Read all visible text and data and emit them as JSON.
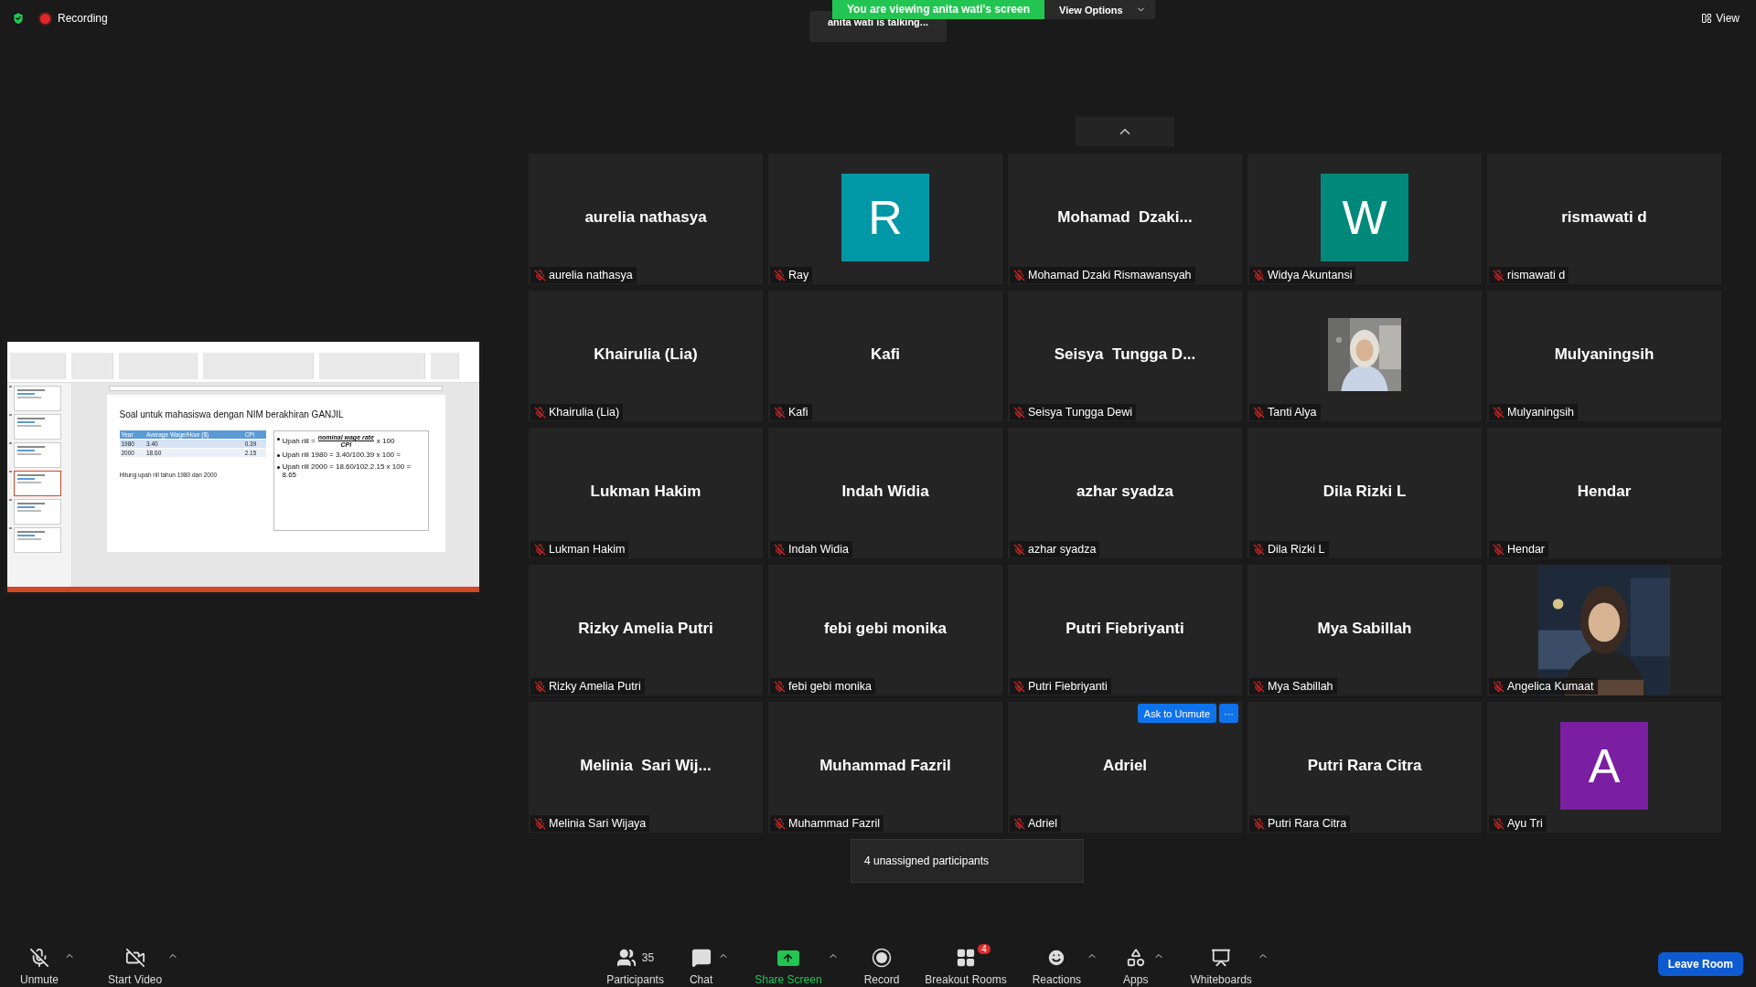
{
  "top_bar": {
    "recording_label": "Recording",
    "banner": "You are viewing anita wati's screen",
    "view_options": "View Options",
    "talking": "anita wati is talking...",
    "view": "View"
  },
  "shared_screen": {
    "slides": [
      {
        "selected": false
      },
      {
        "selected": false
      },
      {
        "selected": false
      },
      {
        "selected": true
      },
      {
        "selected": false
      },
      {
        "selected": false
      }
    ],
    "slide": {
      "title": "Soal untuk mahasiswa dengan NIM berakhiran GANJIL",
      "table": {
        "columns": [
          "Year",
          "Average Wage/Hour ($)",
          "CPI"
        ],
        "rows": [
          [
            "1980",
            "3.40",
            "0.39"
          ],
          [
            "2000",
            "18.60",
            "2.15"
          ]
        ]
      },
      "note": "Hitung upah riil tahun 1980 dan 2000",
      "bullets": [
        {
          "kind": "fraction",
          "before": "Upah riil =",
          "numerator": "nominal wage rate",
          "denominator": "CPI",
          "after": "x 100"
        },
        {
          "kind": "text",
          "text": "Upah riil 1980 = 3.40/100.39 x 100 ="
        },
        {
          "kind": "text",
          "text": "Upah riil 2000 = 18.60/102.2.15 x 100 = 8.65"
        }
      ]
    }
  },
  "tiles": [
    {
      "kind": "name",
      "display": "aurelia nathasya",
      "name": "aurelia nathasya",
      "muted": true
    },
    {
      "kind": "avatar",
      "letter": "R",
      "color": "#0097a7",
      "name": "Ray",
      "muted": true
    },
    {
      "kind": "name",
      "display": "Mohamad  Dzaki...",
      "name": "Mohamad Dzaki Rismawansyah",
      "muted": true
    },
    {
      "kind": "avatar",
      "letter": "W",
      "color": "#00897b",
      "name": "Widya Akuntansi",
      "muted": true
    },
    {
      "kind": "name",
      "display": "rismawati d",
      "name": "rismawati d",
      "muted": true
    },
    {
      "kind": "name",
      "display": "Khairulia (Lia)",
      "name": "Khairulia (Lia)",
      "muted": true
    },
    {
      "kind": "name",
      "display": "Kafi",
      "name": "Kafi",
      "muted": true
    },
    {
      "kind": "name",
      "display": "Seisya  Tungga D...",
      "name": "Seisya Tungga Dewi",
      "muted": true
    },
    {
      "name": "Tanti Alya",
      "muted": true
    },
    {
      "kind": "name",
      "display": "Mulyaningsih",
      "name": "Mulyaningsih",
      "muted": true
    },
    {
      "kind": "name",
      "display": "Lukman Hakim",
      "name": "Lukman Hakim",
      "muted": true
    },
    {
      "kind": "name",
      "display": "Indah Widia",
      "name": "Indah Widia",
      "muted": true
    },
    {
      "kind": "name",
      "display": "azhar syadza",
      "name": "azhar syadza",
      "muted": true
    },
    {
      "kind": "name",
      "display": "Dila Rizki L",
      "name": "Dila Rizki L",
      "muted": true
    },
    {
      "kind": "name",
      "display": "Hendar",
      "name": "Hendar",
      "muted": true
    },
    {
      "kind": "name",
      "display": "Rizky Amelia Putri",
      "name": "Rizky Amelia Putri",
      "muted": true
    },
    {
      "kind": "name",
      "display": "febi gebi monika",
      "name": "febi gebi monika",
      "muted": true
    },
    {
      "kind": "name",
      "display": "Putri Fiebriyanti",
      "name": "Putri Fiebriyanti",
      "muted": true
    },
    {
      "kind": "name",
      "display": "Mya Sabillah",
      "name": "Mya Sabillah",
      "muted": true
    },
    {
      "kind": "video",
      "name": "Angelica Kumaat",
      "muted": true
    },
    {
      "kind": "name",
      "display": "Melinia  Sari Wij...",
      "name": "Melinia Sari Wijaya",
      "muted": true
    },
    {
      "kind": "name",
      "display": "Muhammad Fazril",
      "name": "Muhammad Fazril",
      "muted": true
    },
    {
      "kind": "name",
      "display": "Adriel",
      "name": "Adriel",
      "muted": true,
      "ask_button": "Ask to Unmute",
      "more": "···"
    },
    {
      "kind": "name",
      "display": "Putri Rara Citra",
      "name": "Putri Rara Citra",
      "muted": true
    },
    {
      "kind": "avatar",
      "letter": "A",
      "color": "#7b1fa2",
      "name": "Ayu Tri",
      "muted": true
    }
  ],
  "toolbar": {
    "items": [
      {
        "label": "Unmute",
        "caret": true
      },
      {
        "label": "Start Video",
        "caret": true
      },
      {
        "label": "Participants",
        "count": "35"
      },
      {
        "label": "Chat",
        "caret": true
      },
      {
        "label": "Share Screen",
        "caret": true,
        "highlight": true
      },
      {
        "label": "Record"
      },
      {
        "label": "Breakout Rooms",
        "badge": "4"
      },
      {
        "label": "Reactions",
        "caret": true
      },
      {
        "label": "Apps",
        "caret": true
      },
      {
        "label": "Whiteboards",
        "caret": true
      }
    ],
    "leave": "Leave Room",
    "tooltip": "4 unassigned participants"
  }
}
